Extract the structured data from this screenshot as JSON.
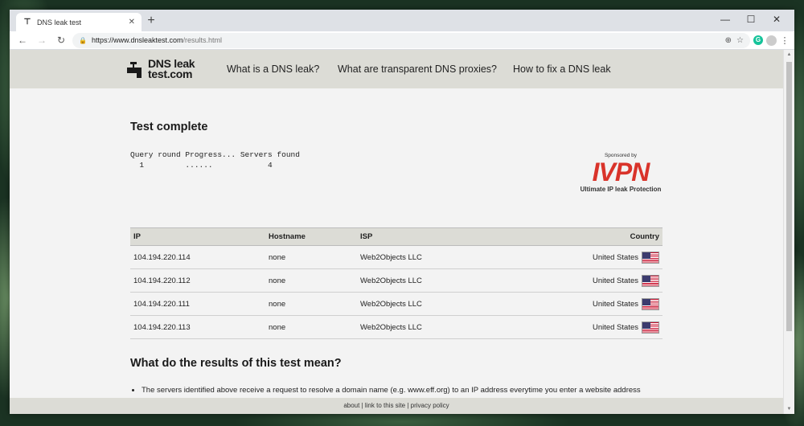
{
  "browser": {
    "tab_title": "DNS leak test",
    "url_host": "https://www.dnsleaktest.com",
    "url_path": "/results.html",
    "new_tab_label": "+",
    "extension_letter": "G"
  },
  "site": {
    "logo_line1": "DNS leak",
    "logo_line2": "test.com",
    "nav": [
      "What is a DNS leak?",
      "What are transparent DNS proxies?",
      "How to fix a DNS leak"
    ]
  },
  "main": {
    "title": "Test complete",
    "progress_header": "Query round Progress... Servers found",
    "progress_values": "  1         ......            4",
    "sponsor": {
      "by": "Sponsored by",
      "brand": "IVPN",
      "tagline": "Ultimate IP leak Protection",
      "brand_color": "#d9332a"
    },
    "table": {
      "headers": [
        "IP",
        "Hostname",
        "ISP",
        "Country"
      ],
      "rows": [
        {
          "ip": "104.194.220.114",
          "hostname": "none",
          "isp": "Web2Objects LLC",
          "country": "United States"
        },
        {
          "ip": "104.194.220.112",
          "hostname": "none",
          "isp": "Web2Objects LLC",
          "country": "United States"
        },
        {
          "ip": "104.194.220.111",
          "hostname": "none",
          "isp": "Web2Objects LLC",
          "country": "United States"
        },
        {
          "ip": "104.194.220.113",
          "hostname": "none",
          "isp": "Web2Objects LLC",
          "country": "United States"
        }
      ]
    },
    "meaning_title": "What do the results of this test mean?",
    "explain_item": "The servers identified above receive a request to resolve a domain name (e.g. www.eff.org) to an IP address everytime you enter a website address"
  },
  "footer": {
    "about": "about",
    "link": "link to this site",
    "privacy": "privacy policy",
    "separator": " | "
  }
}
